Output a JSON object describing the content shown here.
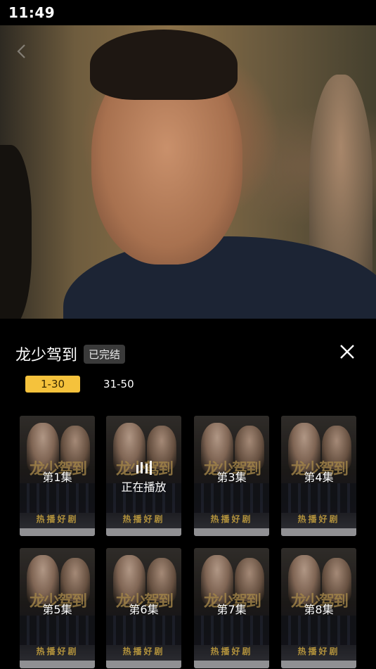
{
  "status_bar": {
    "time": "11:49"
  },
  "video": {
    "back_icon": "chevron-left-icon"
  },
  "drama": {
    "title": "龙少驾到",
    "status_badge": "已完结",
    "close_icon": "close-icon"
  },
  "tabs": [
    {
      "label": "1-30",
      "active": true
    },
    {
      "label": "31-50",
      "active": false
    }
  ],
  "poster": {
    "calligraphy": "龙少驾到",
    "footer_text": "热播好剧"
  },
  "episodes": [
    {
      "label": "第1集"
    },
    {
      "label": "正在播放",
      "playing": true,
      "icon": "now-playing-icon"
    },
    {
      "label": "第3集"
    },
    {
      "label": "第4集"
    },
    {
      "label": "第5集"
    },
    {
      "label": "第6集"
    },
    {
      "label": "第7集"
    },
    {
      "label": "第8集"
    }
  ],
  "colors": {
    "accent": "#f5c23c",
    "background": "#000000",
    "badge_bg": "#3a3a3a"
  }
}
